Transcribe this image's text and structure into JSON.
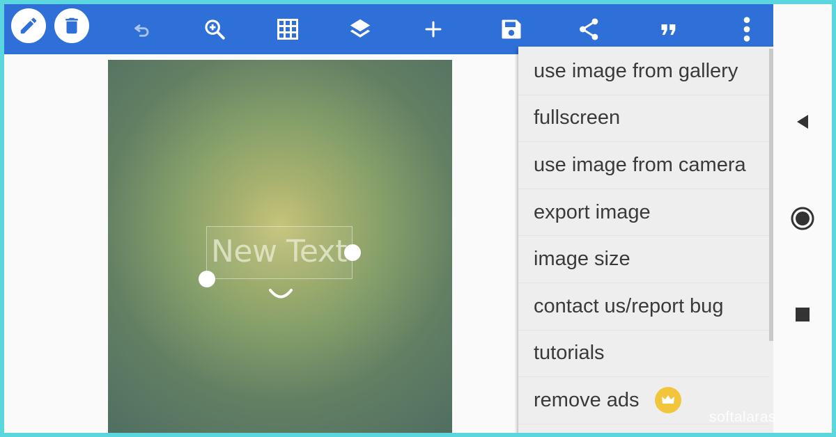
{
  "toolbar": {
    "buttons": [
      {
        "name": "pencil-button",
        "icon": "pencil-icon"
      },
      {
        "name": "trash-button",
        "icon": "trash-icon"
      },
      {
        "name": "undo-button",
        "icon": "undo-icon"
      },
      {
        "name": "zoom-in-button",
        "icon": "zoom-in-icon"
      },
      {
        "name": "grid-button",
        "icon": "grid-icon"
      },
      {
        "name": "layers-button",
        "icon": "layers-icon"
      },
      {
        "name": "add-button",
        "icon": "plus-icon"
      },
      {
        "name": "save-button",
        "icon": "floppy-disk-icon"
      },
      {
        "name": "share-button",
        "icon": "share-icon"
      },
      {
        "name": "quote-button",
        "icon": "quote-icon"
      },
      {
        "name": "overflow-menu-button",
        "icon": "more-vertical-icon"
      }
    ],
    "color": "#2f6fd8"
  },
  "canvas": {
    "text": "New Text"
  },
  "menu": {
    "items": [
      {
        "label": "use image from gallery"
      },
      {
        "label": "fullscreen"
      },
      {
        "label": "use image from camera"
      },
      {
        "label": "export image"
      },
      {
        "label": "image size"
      },
      {
        "label": "contact us/report bug"
      },
      {
        "label": "tutorials"
      },
      {
        "label": "remove ads",
        "icon": "crown-icon"
      }
    ]
  },
  "navbar": {
    "buttons": [
      {
        "name": "back-button",
        "icon": "triangle-left-icon"
      },
      {
        "name": "home-button",
        "icon": "circle-home-icon"
      },
      {
        "name": "recents-button",
        "icon": "square-recents-icon"
      }
    ]
  },
  "watermark": "softalaras"
}
